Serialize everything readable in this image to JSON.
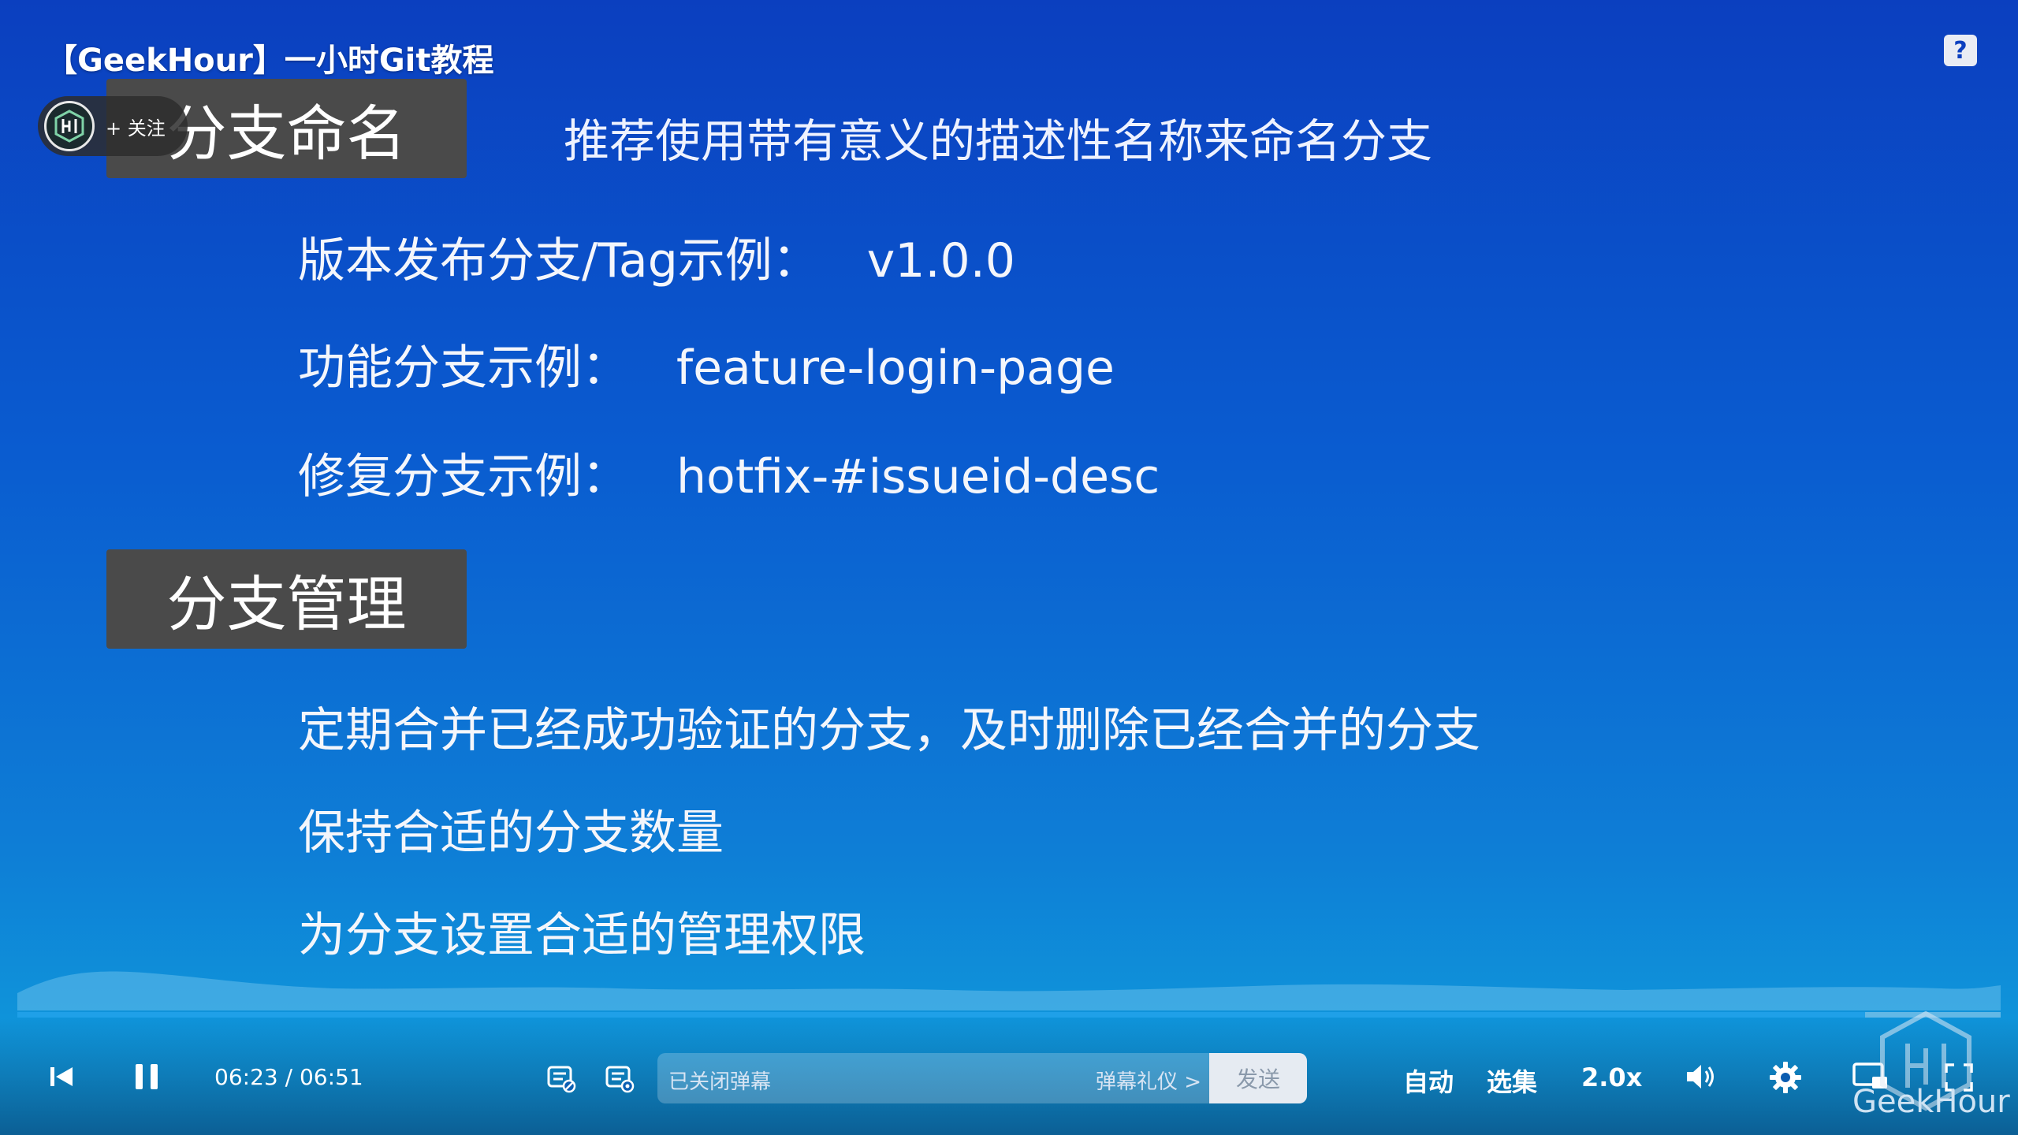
{
  "video": {
    "title": "【GeekHour】一小时Git教程"
  },
  "uploader": {
    "follow_label": "+ 关注"
  },
  "slide": {
    "section1": {
      "heading": "分支命名",
      "subtitle": "推荐使用带有意义的描述性名称来命名分支",
      "items": [
        {
          "label": "版本发布分支/Tag示例：",
          "value": "v1.0.0"
        },
        {
          "label": "功能分支示例：",
          "value": "feature-login-page"
        },
        {
          "label": "修复分支示例：",
          "value": "hotfix-#issueid-desc"
        }
      ]
    },
    "section2": {
      "heading": "分支管理",
      "items": [
        "定期合并已经成功验证的分支，及时删除已经合并的分支",
        "保持合适的分支数量",
        "为分支设置合适的管理权限"
      ]
    }
  },
  "player": {
    "current_time": "06:23",
    "separator": "/",
    "duration": "06:51",
    "progress_fraction": 0.9316,
    "danmaku_placeholder": "已关闭弹幕",
    "danmaku_etiquette": "弹幕礼仪 >",
    "send_label": "发送",
    "auto_label": "自动",
    "episodes_label": "选集",
    "speed_label": "2.0x"
  },
  "watermark": {
    "text": "GeekHour"
  },
  "icons": {
    "help": "help-icon",
    "prev": "skip-back-icon",
    "pause": "pause-icon",
    "danmaku_toggle": "danmaku-toggle-icon",
    "danmaku_settings": "danmaku-settings-icon",
    "volume": "volume-icon",
    "settings": "gear-icon",
    "pip": "picture-in-picture-icon",
    "fullscreen": "fullscreen-icon"
  }
}
